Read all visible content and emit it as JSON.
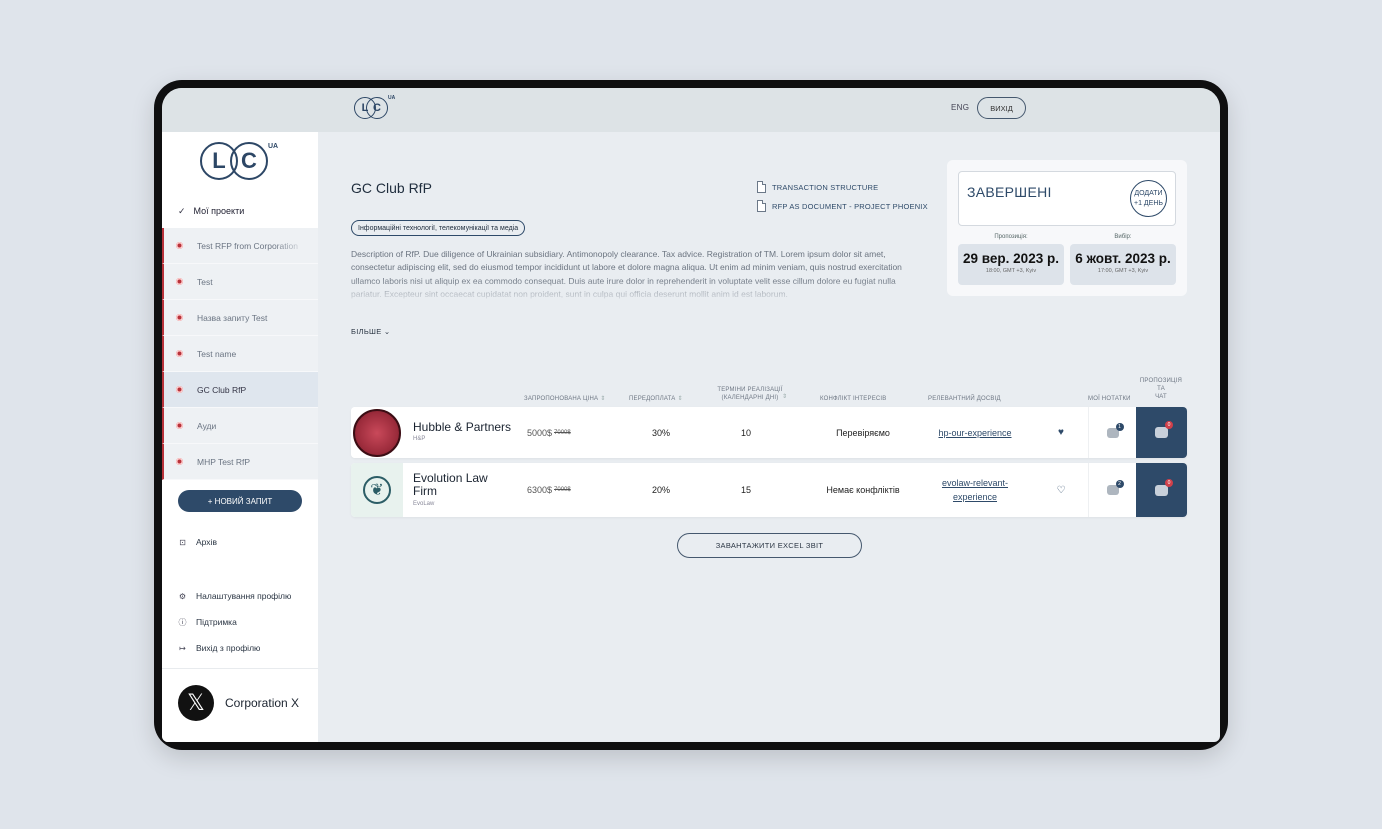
{
  "header": {
    "logo_letters": [
      "L",
      "C"
    ],
    "logo_ua": "UA",
    "lang": "ENG",
    "logout": "ВИХІД"
  },
  "sidebar": {
    "my_projects": "Мої проекти",
    "projects": [
      {
        "label": "Test RFP from Corporation"
      },
      {
        "label": "Test"
      },
      {
        "label": "Назва запиту Test"
      },
      {
        "label": "Test name"
      },
      {
        "label": "GC Club RfP"
      },
      {
        "label": "Ауди"
      },
      {
        "label": "MHP Test RfP"
      }
    ],
    "new_request": "+ НОВИЙ ЗАПИТ",
    "archive": "Архів",
    "settings": "Налаштування профілю",
    "support": "Підтримка",
    "exit": "Вихід з профілю",
    "user_name": "Corporation X"
  },
  "rfp": {
    "title": "GC Club RfP",
    "doc1": "TRANSACTION STRUCTURE",
    "doc2": "RFP AS DOCUMENT - PROJECT PHOENIX",
    "industry": "Інформаційні технології, телекомунікації та медіа",
    "description": "Description of RfP. Due diligence of Ukrainian subsidiary. Antimonopoly clearance. Tax advice. Registration of TM. Lorem ipsum dolor sit amet, consectetur adipiscing elit, sed do eiusmod tempor incididunt ut labore et dolore magna aliqua. Ut enim ad minim veniam, quis nostrud exercitation ullamco laboris nisi ut aliquip ex ea commodo consequat. Duis aute irure dolor in reprehenderit in voluptate velit esse cillum dolore eu fugiat nulla pariatur. Excepteur sint occaecat cupidatat non proident, sunt in culpa qui officia deserunt mollit anim id est laborum.",
    "more": "БІЛЬШЕ"
  },
  "status": {
    "label": "ЗАВЕРШЕНІ",
    "add_line1": "ДОДАТИ",
    "add_line2": "+1 ДЕНЬ",
    "proposal_label": "Пропозиція:",
    "choice_label": "Вибір:",
    "proposal_date": "29 вер. 2023 р.",
    "proposal_time": "18:00, GMT +3, Kyiv",
    "choice_date": "6 жовт. 2023 р.",
    "choice_time": "17:00, GMT +3, Kyiv"
  },
  "table": {
    "headers": {
      "price": "ЗАПРОПОНОВАНА ЦІНА",
      "prepay": "ПЕРЕДОПЛАТА",
      "term_l1": "ТЕРМІНИ РЕАЛІЗАЦІЇ",
      "term_l2": "(КАЛЕНДАРНІ ДНІ)",
      "conflict": "КОНФЛІКТ ІНТЕРЕСІВ",
      "experience": "РЕЛЕВАНТНИЙ ДОСВІД",
      "notes": "МОЇ НОТАТКИ",
      "chat_l1": "ПРОПОЗИЦІЯ",
      "chat_l2": "ТА",
      "chat_l3": "ЧАТ"
    },
    "rows": [
      {
        "firm": "Hubble & Partners",
        "short": "H&P",
        "price": "5000$",
        "old_price": "7000$",
        "prepay": "30%",
        "term": "10",
        "conflict": "Перевіряємо",
        "experience": "hp-our-experience",
        "favorite": true,
        "notes_count": "1",
        "chat_count": "0"
      },
      {
        "firm": "Evolution Law Firm",
        "short": "EvoLaw",
        "price": "6300$",
        "old_price": "7000$",
        "prepay": "20%",
        "term": "15",
        "conflict": "Немає конфліктів",
        "experience": "evolaw-relevant-experience",
        "favorite": false,
        "notes_count": "2",
        "chat_count": "0"
      }
    ]
  },
  "excel_button": "ЗАВАНТАЖИТИ EXCEL ЗВІТ",
  "colors": {
    "primary": "#2e4a69",
    "accent_red": "#b8323a",
    "background": "#dfe4eb"
  }
}
